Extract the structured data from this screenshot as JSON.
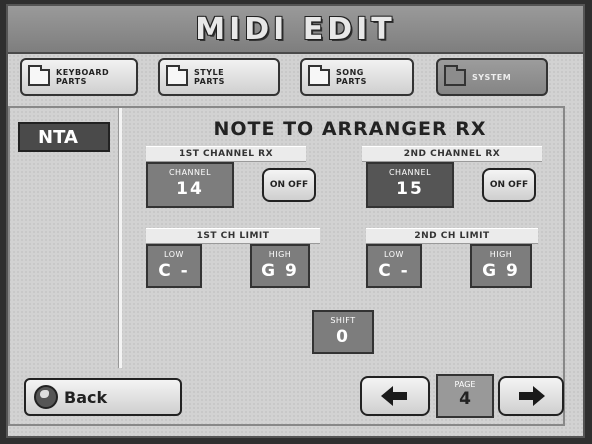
{
  "header": {
    "title": "MIDI EDIT"
  },
  "tabs": [
    {
      "label": "KEYBOARD\nPARTS",
      "active": false
    },
    {
      "label": "STYLE\nPARTS",
      "active": false
    },
    {
      "label": "SONG\nPARTS",
      "active": false
    },
    {
      "label": "SYSTEM",
      "active": true
    }
  ],
  "sidebar": {
    "tag": "NTA"
  },
  "main": {
    "heading": "NOTE TO ARRANGER RX",
    "channel1": {
      "section_label": "1ST CHANNEL RX",
      "box_label": "CHANNEL",
      "value": "14",
      "toggle_label": "ON OFF"
    },
    "channel2": {
      "section_label": "2ND CHANNEL RX",
      "box_label": "CHANNEL",
      "value": "15",
      "toggle_label": "ON OFF"
    },
    "limit1": {
      "section_label": "1ST CH LIMIT",
      "low_label": "LOW",
      "low_value": "C -",
      "high_label": "HIGH",
      "high_value": "G 9"
    },
    "limit2": {
      "section_label": "2ND CH LIMIT",
      "low_label": "LOW",
      "low_value": "C -",
      "high_label": "HIGH",
      "high_value": "G 9"
    },
    "shift": {
      "label": "SHIFT",
      "value": "0"
    }
  },
  "footer": {
    "back_label": "Back",
    "page_label": "PAGE",
    "page_value": "4"
  },
  "icons": [
    "folder-icon",
    "globe-icon",
    "arrow-left-icon",
    "arrow-right-icon"
  ],
  "colors": {
    "title_bar": "#8a8a8a",
    "panel": "#d2d2d2",
    "value_box": "#7d7d7d"
  }
}
